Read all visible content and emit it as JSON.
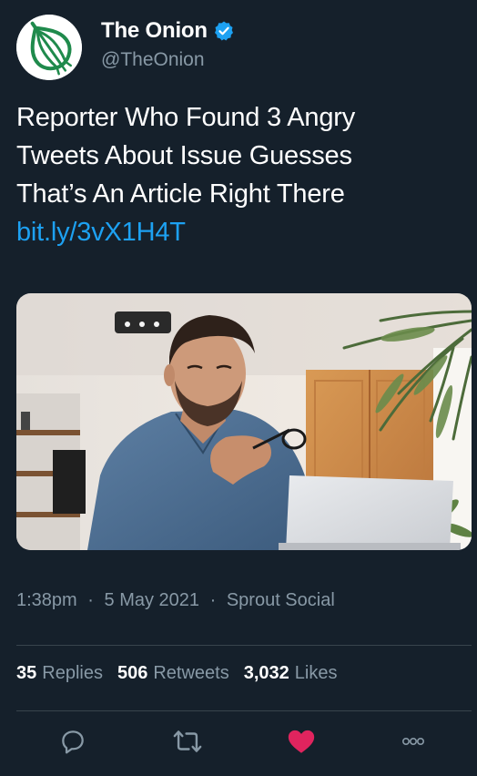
{
  "tweet": {
    "author": {
      "display_name": "The Onion",
      "handle": "@TheOnion",
      "verified": true,
      "avatar_icon": "onion-logo-icon"
    },
    "text_lines": [
      "Reporter Who Found 3 Angry",
      "Tweets About Issue Guesses",
      "That’s An Article Right There"
    ],
    "link": "bit.ly/3vX1H4T",
    "media": {
      "description_icon": "photo-man-at-laptop"
    },
    "meta": {
      "time": "1:38pm",
      "date": "5 May 2021",
      "source": "Sprout Social",
      "separator": "·"
    },
    "stats": {
      "replies_count": "35",
      "replies_label": "Replies",
      "retweets_count": "506",
      "retweets_label": "Retweets",
      "likes_count": "3,032",
      "likes_label": "Likes"
    },
    "actions": {
      "reply_icon": "reply-icon",
      "retweet_icon": "retweet-icon",
      "like_icon": "heart-icon",
      "more_icon": "more-icon",
      "liked": true
    }
  },
  "colors": {
    "background": "#15202b",
    "text_primary": "#ffffff",
    "text_secondary": "#8899a6",
    "link": "#1da1f2",
    "divider": "#38444d",
    "like_active": "#e0245e",
    "verified": "#1da1f2",
    "icon": "#8899a6",
    "onion_green": "#1f8a4c"
  }
}
